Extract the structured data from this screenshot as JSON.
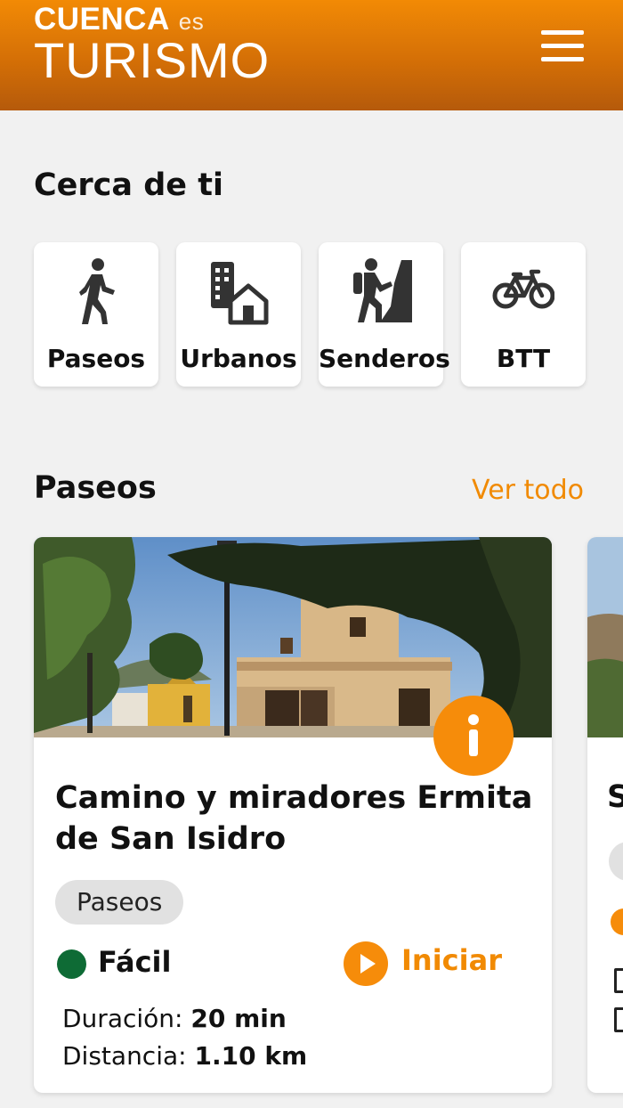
{
  "header": {
    "logo_top": "CUENCA",
    "logo_es": "es",
    "logo_bottom": "TURISMO",
    "menu_icon": "hamburger-menu-icon"
  },
  "nearby": {
    "title": "Cerca de ti",
    "categories": [
      {
        "label": "Paseos",
        "icon": "walking-person-icon"
      },
      {
        "label": "Urbanos",
        "icon": "city-buildings-icon"
      },
      {
        "label": "Senderos",
        "icon": "hiker-icon"
      },
      {
        "label": "BTT",
        "icon": "bicycle-icon"
      }
    ]
  },
  "paseos_section": {
    "title": "Paseos",
    "see_all": "Ver todo"
  },
  "route_card": {
    "title": "Camino y miradores Ermita de San Isidro",
    "chip": "Paseos",
    "difficulty": "Fácil",
    "difficulty_color": "#0e6b35",
    "start_label": "Iniciar",
    "duration_label": "Duración:",
    "duration_value": "20 min",
    "distance_label": "Distancia:",
    "distance_value": "1.10 km"
  },
  "peek_card": {
    "title_initial": "S"
  },
  "colors": {
    "accent": "#f18a03",
    "header_top": "#f28a05",
    "header_bottom": "#b55a0b",
    "background": "#f1f1f1"
  }
}
